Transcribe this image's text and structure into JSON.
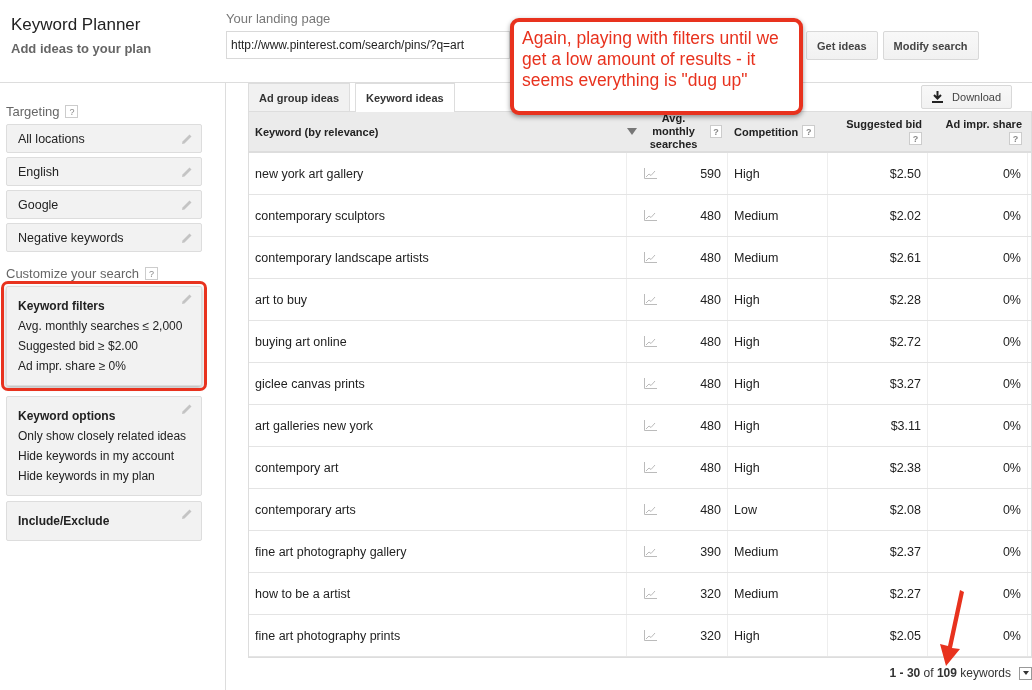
{
  "header": {
    "title": "Keyword Planner",
    "subtitle": "Add ideas to your plan",
    "landing_label": "Your landing page",
    "landing_value": "http://www.pinterest.com/search/pins/?q=art",
    "buttons": [
      "Get ideas",
      "Modify search"
    ]
  },
  "sidebar": {
    "targeting": {
      "title": "Targeting",
      "help": "?",
      "items": [
        "All locations",
        "English",
        "Google",
        "Negative keywords"
      ]
    },
    "customize": {
      "title": "Customize your search",
      "help": "?",
      "cards": [
        {
          "title": "Keyword filters",
          "lines": [
            "Avg. monthly searches ≤ 2,000",
            "Suggested bid ≥ $2.00",
            "Ad impr. share ≥ 0%"
          ],
          "highlighted": true
        },
        {
          "title": "Keyword options",
          "lines": [
            "Only show closely related ideas",
            "Hide keywords in my account",
            "Hide keywords in my plan"
          ],
          "highlighted": false
        },
        {
          "title": "Include/Exclude",
          "highlighted": false
        }
      ]
    }
  },
  "tabs": [
    {
      "label": "Ad group ideas",
      "selected": false
    },
    {
      "label": "Keyword ideas",
      "selected": true
    }
  ],
  "download_button": "Download",
  "table": {
    "columns": [
      {
        "label": "Keyword (by relevance)",
        "sorted": false
      },
      {
        "label": "Avg. monthly searches",
        "help": "?",
        "sorted": true
      },
      {
        "label": "Competition",
        "help": "?",
        "sorted": false
      },
      {
        "label": "Suggested bid",
        "help": "?",
        "sorted": false
      },
      {
        "label": "Ad impr. share",
        "help": "?",
        "sorted": false
      }
    ],
    "rows": [
      [
        "new york art gallery",
        "590",
        "High",
        "$2.50",
        "0%"
      ],
      [
        "contemporary sculptors",
        "480",
        "Medium",
        "$2.02",
        "0%"
      ],
      [
        "contemporary landscape artists",
        "480",
        "Medium",
        "$2.61",
        "0%"
      ],
      [
        "art to buy",
        "480",
        "High",
        "$2.28",
        "0%"
      ],
      [
        "buying art online",
        "480",
        "High",
        "$2.72",
        "0%"
      ],
      [
        "giclee canvas prints",
        "480",
        "High",
        "$3.27",
        "0%"
      ],
      [
        "art galleries new york",
        "480",
        "High",
        "$3.11",
        "0%"
      ],
      [
        "contempory art",
        "480",
        "High",
        "$2.38",
        "0%"
      ],
      [
        "contemporary arts",
        "480",
        "Low",
        "$2.08",
        "0%"
      ],
      [
        "fine art photography gallery",
        "390",
        "Medium",
        "$2.37",
        "0%"
      ],
      [
        "how to be a artist",
        "320",
        "Medium",
        "$2.27",
        "0%"
      ],
      [
        "fine art photography prints",
        "320",
        "High",
        "$2.05",
        "0%"
      ]
    ]
  },
  "pager": "**1 - 30** of **109** keywords",
  "annotation": "Again, playing with filters until we get a low amount of results - it seems everything is \"dug up\""
}
